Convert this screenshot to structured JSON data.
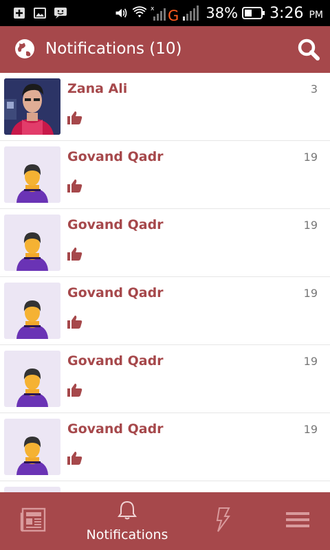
{
  "status_bar": {
    "battery": "38%",
    "time": "3:26",
    "ampm": "PM",
    "network": "G"
  },
  "app_bar": {
    "title": "Notifications (10)"
  },
  "notifications": [
    {
      "name": "Zana Ali",
      "count": "3",
      "avatar": "photo"
    },
    {
      "name": "Govand Qadr",
      "count": "19",
      "avatar": "default"
    },
    {
      "name": "Govand Qadr",
      "count": "19",
      "avatar": "default"
    },
    {
      "name": "Govand Qadr",
      "count": "19",
      "avatar": "default"
    },
    {
      "name": "Govand Qadr",
      "count": "19",
      "avatar": "default"
    },
    {
      "name": "Govand Qadr",
      "count": "19",
      "avatar": "default"
    }
  ],
  "bottom_nav": {
    "notifications_label": "Notifications"
  },
  "colors": {
    "primary": "#a6484b",
    "avatar_bg": "#ece6f4"
  }
}
